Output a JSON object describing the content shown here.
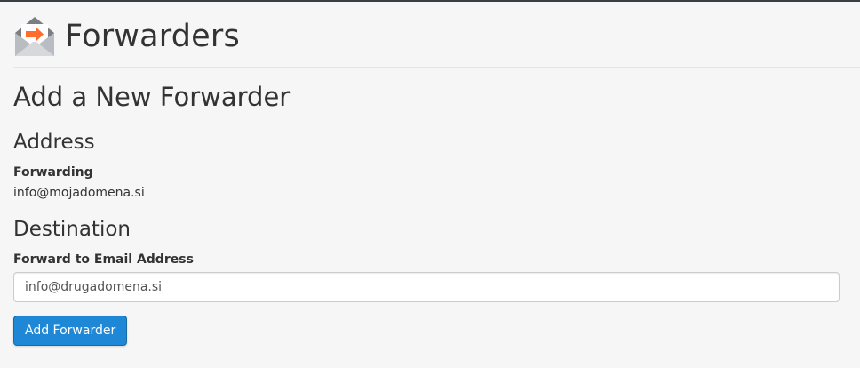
{
  "header": {
    "title": "Forwarders",
    "icon": "email-forward-icon"
  },
  "main": {
    "heading": "Add a New Forwarder",
    "address": {
      "heading": "Address",
      "label": "Forwarding",
      "value": "info@mojadomena.si"
    },
    "destination": {
      "heading": "Destination",
      "label": "Forward to Email Address",
      "input_value": "info@drugadomena.si"
    },
    "submit_label": "Add Forwarder"
  },
  "colors": {
    "accent": "#1e87d6",
    "icon_arrow": "#ff6c2c",
    "icon_envelope": "#6b6f74"
  }
}
